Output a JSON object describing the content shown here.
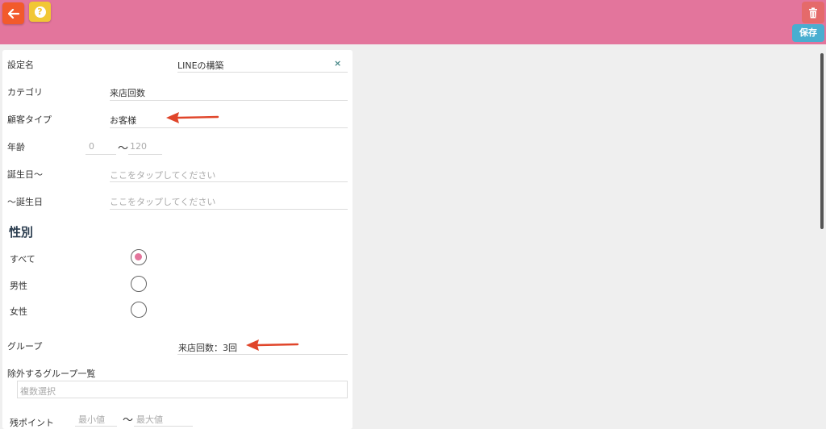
{
  "header": {
    "save_label": "保存",
    "help_label": "?"
  },
  "form": {
    "setting_name": {
      "label": "設定名",
      "value": "LINEの構築",
      "clear": "×"
    },
    "category": {
      "label": "カテゴリ",
      "value": "来店回数"
    },
    "customer_type": {
      "label": "顧客タイプ",
      "value": "お客様"
    },
    "age": {
      "label": "年齢",
      "min": "0",
      "tilde": "〜",
      "max": "120"
    },
    "birthday_from": {
      "label": "誕生日〜",
      "placeholder": "ここをタップしてください"
    },
    "birthday_to": {
      "label": "〜誕生日",
      "placeholder": "ここをタップしてください"
    },
    "gender": {
      "title": "性別",
      "options": [
        {
          "label": "すべて",
          "selected": true
        },
        {
          "label": "男性",
          "selected": false
        },
        {
          "label": "女性",
          "selected": false
        }
      ]
    },
    "group": {
      "label": "グループ",
      "value": "来店回数：3回"
    },
    "exclude_groups": {
      "label": "除外するグループ一覧",
      "placeholder": "複数選択"
    },
    "remaining_points": {
      "label": "残ポイント",
      "min_placeholder": "最小値",
      "tilde": "〜",
      "max_placeholder": "最大値"
    }
  },
  "colors": {
    "header": "#e3759c",
    "back": "#f25a2c",
    "help": "#f1c735",
    "trash": "#e56a6a",
    "save": "#4aaed0",
    "annotation_arrow": "#e0452a"
  }
}
